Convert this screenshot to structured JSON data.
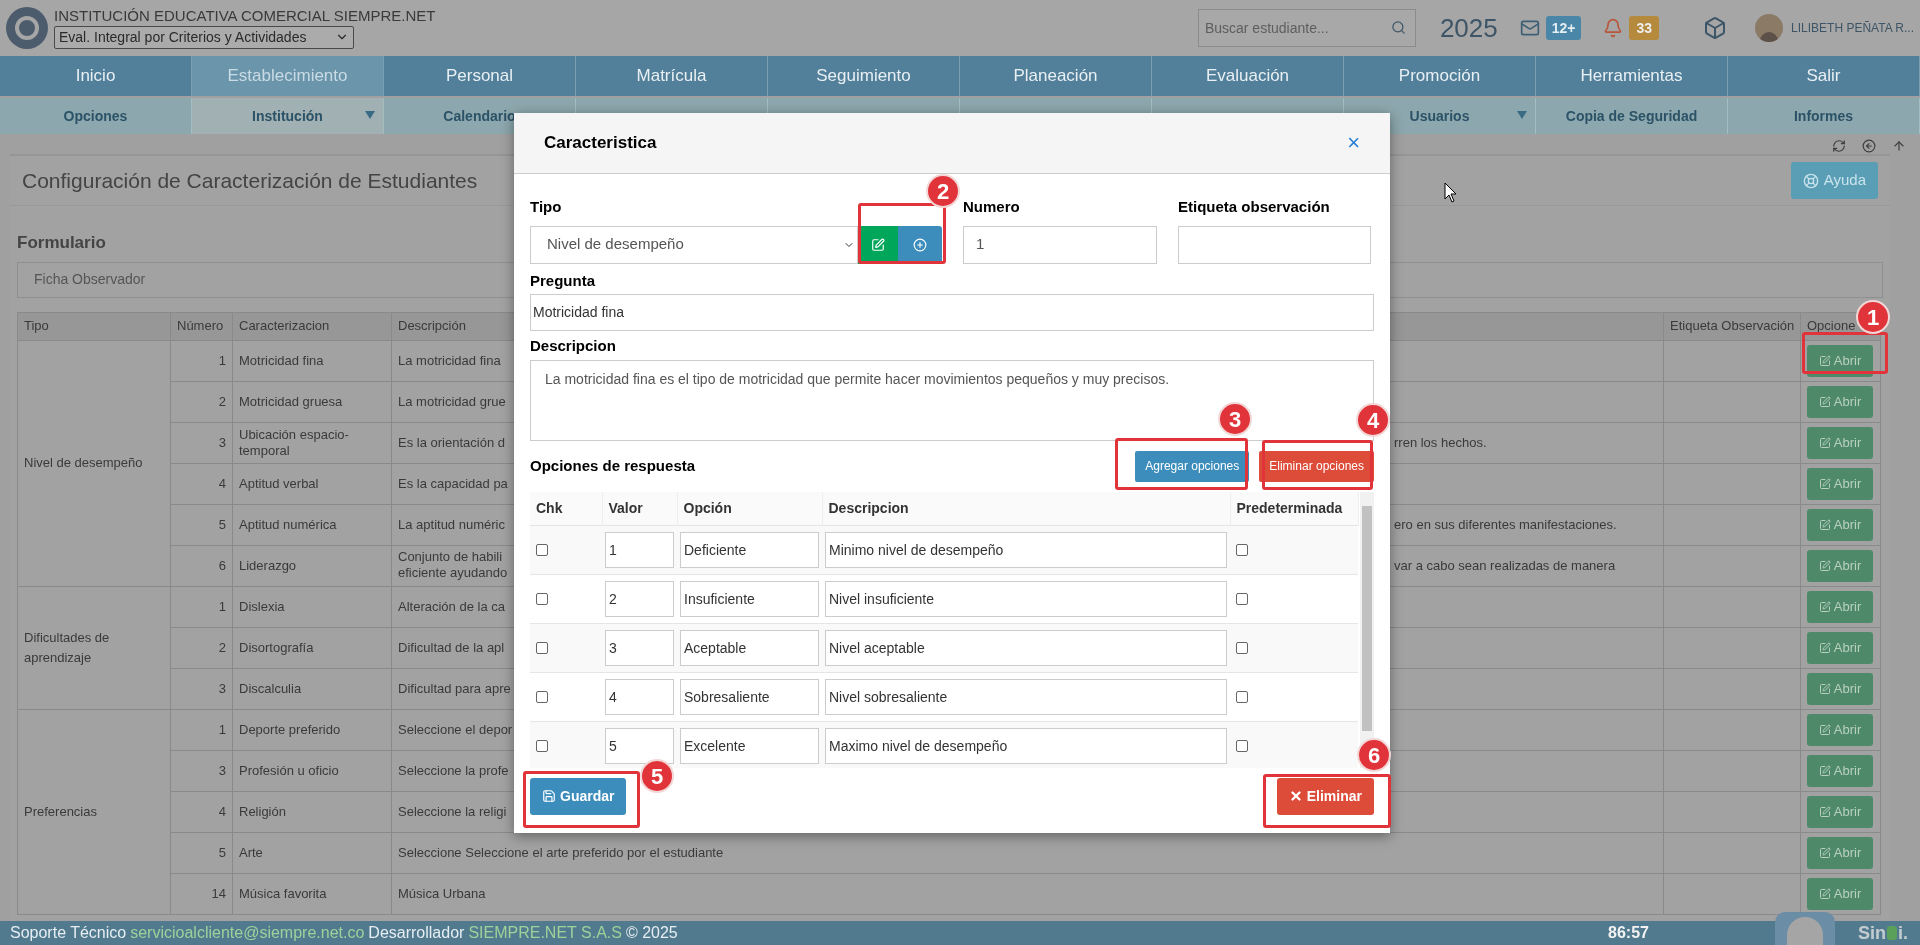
{
  "header": {
    "institution": "INSTITUCIÓN EDUCATIVA COMERCIAL SIEMPRE.NET",
    "evaluation_select": "Eval. Integral por Criterios y Actividades",
    "search": {
      "placeholder": "Buscar estudiante..."
    },
    "year": "2025",
    "messages_badge": "12+",
    "alerts_badge": "33",
    "user": "LILIBETH PEÑATA R..."
  },
  "menu": [
    {
      "label": "Inicio",
      "selected": false
    },
    {
      "label": "Establecimiento",
      "selected": true
    },
    {
      "label": "Personal",
      "selected": false
    },
    {
      "label": "Matrícula",
      "selected": false
    },
    {
      "label": "Seguimiento",
      "selected": false
    },
    {
      "label": "Planeación",
      "selected": false
    },
    {
      "label": "Evaluación",
      "selected": false
    },
    {
      "label": "Promoción",
      "selected": false
    },
    {
      "label": "Herramientas",
      "selected": false
    },
    {
      "label": "Salir",
      "selected": false
    }
  ],
  "submenu_left": [
    {
      "label": "Opciones",
      "dropdown": false,
      "selected": false
    },
    {
      "label": "Institución",
      "dropdown": true,
      "selected": true
    },
    {
      "label": "Calendario",
      "dropdown": false,
      "selected": false
    }
  ],
  "submenu_right": [
    {
      "label": "Usuarios",
      "dropdown": true,
      "selected": false
    },
    {
      "label": "Copia de Seguridad",
      "dropdown": false,
      "selected": false
    },
    {
      "label": "Informes",
      "dropdown": false,
      "selected": false
    }
  ],
  "page": {
    "title": "Configuración de Caracterización de Estudiantes",
    "help_button": "Ayuda",
    "form_label": "Formulario",
    "form_select": "Ficha Observador"
  },
  "table": {
    "columns": [
      "Tipo",
      "Número",
      "Caracterizacion",
      "Descripción",
      "Etiqueta Observación",
      "Opcione"
    ],
    "groups": [
      {
        "tipo": "Nivel de desempeño",
        "rows": [
          {
            "numero": "1",
            "caracterizacion": "Motricidad fina",
            "desc_left": "La motricidad fina",
            "action": "Abrir"
          },
          {
            "numero": "2",
            "caracterizacion": "Motricidad gruesa",
            "desc_left": "La motricidad grue",
            "action": "Abrir"
          },
          {
            "numero": "3",
            "caracterizacion": "Ubicación espacio-temporal",
            "desc_left": "Es la orientación d",
            "desc_right": "rren los hechos.",
            "action": "Abrir"
          },
          {
            "numero": "4",
            "caracterizacion": "Aptitud verbal",
            "desc_left": "Es la capacidad pa",
            "action": "Abrir"
          },
          {
            "numero": "5",
            "caracterizacion": "Aptitud numérica",
            "desc_left": "La aptitud numéric",
            "desc_right": "ero en sus diferentes manifestaciones.",
            "action": "Abrir"
          },
          {
            "numero": "6",
            "caracterizacion": "Liderazgo",
            "desc_left": "Conjunto de habili\neficiente ayudando",
            "desc_right": "var a cabo sean realizadas de manera",
            "action": "Abrir"
          }
        ]
      },
      {
        "tipo": "Dificultades de aprendizaje",
        "rows": [
          {
            "numero": "1",
            "caracterizacion": "Dislexia",
            "desc_left": "Alteración de la ca",
            "action": "Abrir"
          },
          {
            "numero": "2",
            "caracterizacion": "Disortografía",
            "desc_left": "Dificultad de la apl",
            "action": "Abrir"
          },
          {
            "numero": "3",
            "caracterizacion": "Discalculia",
            "desc_left": "Dificultad para apre",
            "action": "Abrir"
          }
        ]
      },
      {
        "tipo": "Preferencias",
        "rows": [
          {
            "numero": "1",
            "caracterizacion": "Deporte preferido",
            "desc_left": "Seleccione el depor",
            "action": "Abrir"
          },
          {
            "numero": "3",
            "caracterizacion": "Profesión u oficio",
            "desc_left": "Seleccione la profe",
            "action": "Abrir"
          },
          {
            "numero": "4",
            "caracterizacion": "Religión",
            "desc_left": "Seleccione la religi",
            "action": "Abrir"
          },
          {
            "numero": "5",
            "caracterizacion": "Arte",
            "desc_left": "Seleccione Seleccione el arte preferido por el estudiante",
            "action": "Abrir"
          },
          {
            "numero": "14",
            "caracterizacion": "Música favorita",
            "desc_left": "Música Urbana",
            "action": "Abrir"
          }
        ]
      }
    ]
  },
  "modal": {
    "title": "Caracteristica",
    "close": "×",
    "tipo_label": "Tipo",
    "tipo_value": "Nivel de desempeño",
    "numero_label": "Numero",
    "numero_value": "1",
    "etiqueta_label": "Etiqueta observación",
    "pregunta_label": "Pregunta",
    "pregunta_value": "Motricidad fina",
    "descripcion_label": "Descripcion",
    "descripcion_value": "La motricidad fina es el tipo de motricidad que permite hacer movimientos pequeños y muy precisos.",
    "options_label": "Opciones de respuesta",
    "add_button": "Agregar opciones",
    "remove_button": "Eliminar opciones",
    "columns": [
      "Chk",
      "Valor",
      "Opción",
      "Descripcion",
      "Predeterminada"
    ],
    "options": [
      {
        "checked": false,
        "valor": "1",
        "opcion": "Deficiente",
        "descripcion": "Minimo nivel de desempeño",
        "default": false
      },
      {
        "checked": false,
        "valor": "2",
        "opcion": "Insuficiente",
        "descripcion": "Nivel insuficiente",
        "default": false
      },
      {
        "checked": false,
        "valor": "3",
        "opcion": "Aceptable",
        "descripcion": "Nivel aceptable",
        "default": false
      },
      {
        "checked": false,
        "valor": "4",
        "opcion": "Sobresaliente",
        "descripcion": "Nivel sobresaliente",
        "default": false
      },
      {
        "checked": false,
        "valor": "5",
        "opcion": "Excelente",
        "descripcion": "Maximo nivel de desempeño",
        "default": false
      }
    ],
    "save_button": "Guardar",
    "delete_button": "Eliminar"
  },
  "annotations": [
    "1",
    "2",
    "3",
    "4",
    "5",
    "6"
  ],
  "footer": {
    "support_label": "Soporte Técnico",
    "support_email": "servicioalcliente@siempre.net.co",
    "developer_label": "Desarrollador",
    "developer": "SIEMPRE.NET S.A.S",
    "copyright": "© 2025",
    "timer": "86:57",
    "logo_left": "Sin",
    "logo_right": "i."
  }
}
